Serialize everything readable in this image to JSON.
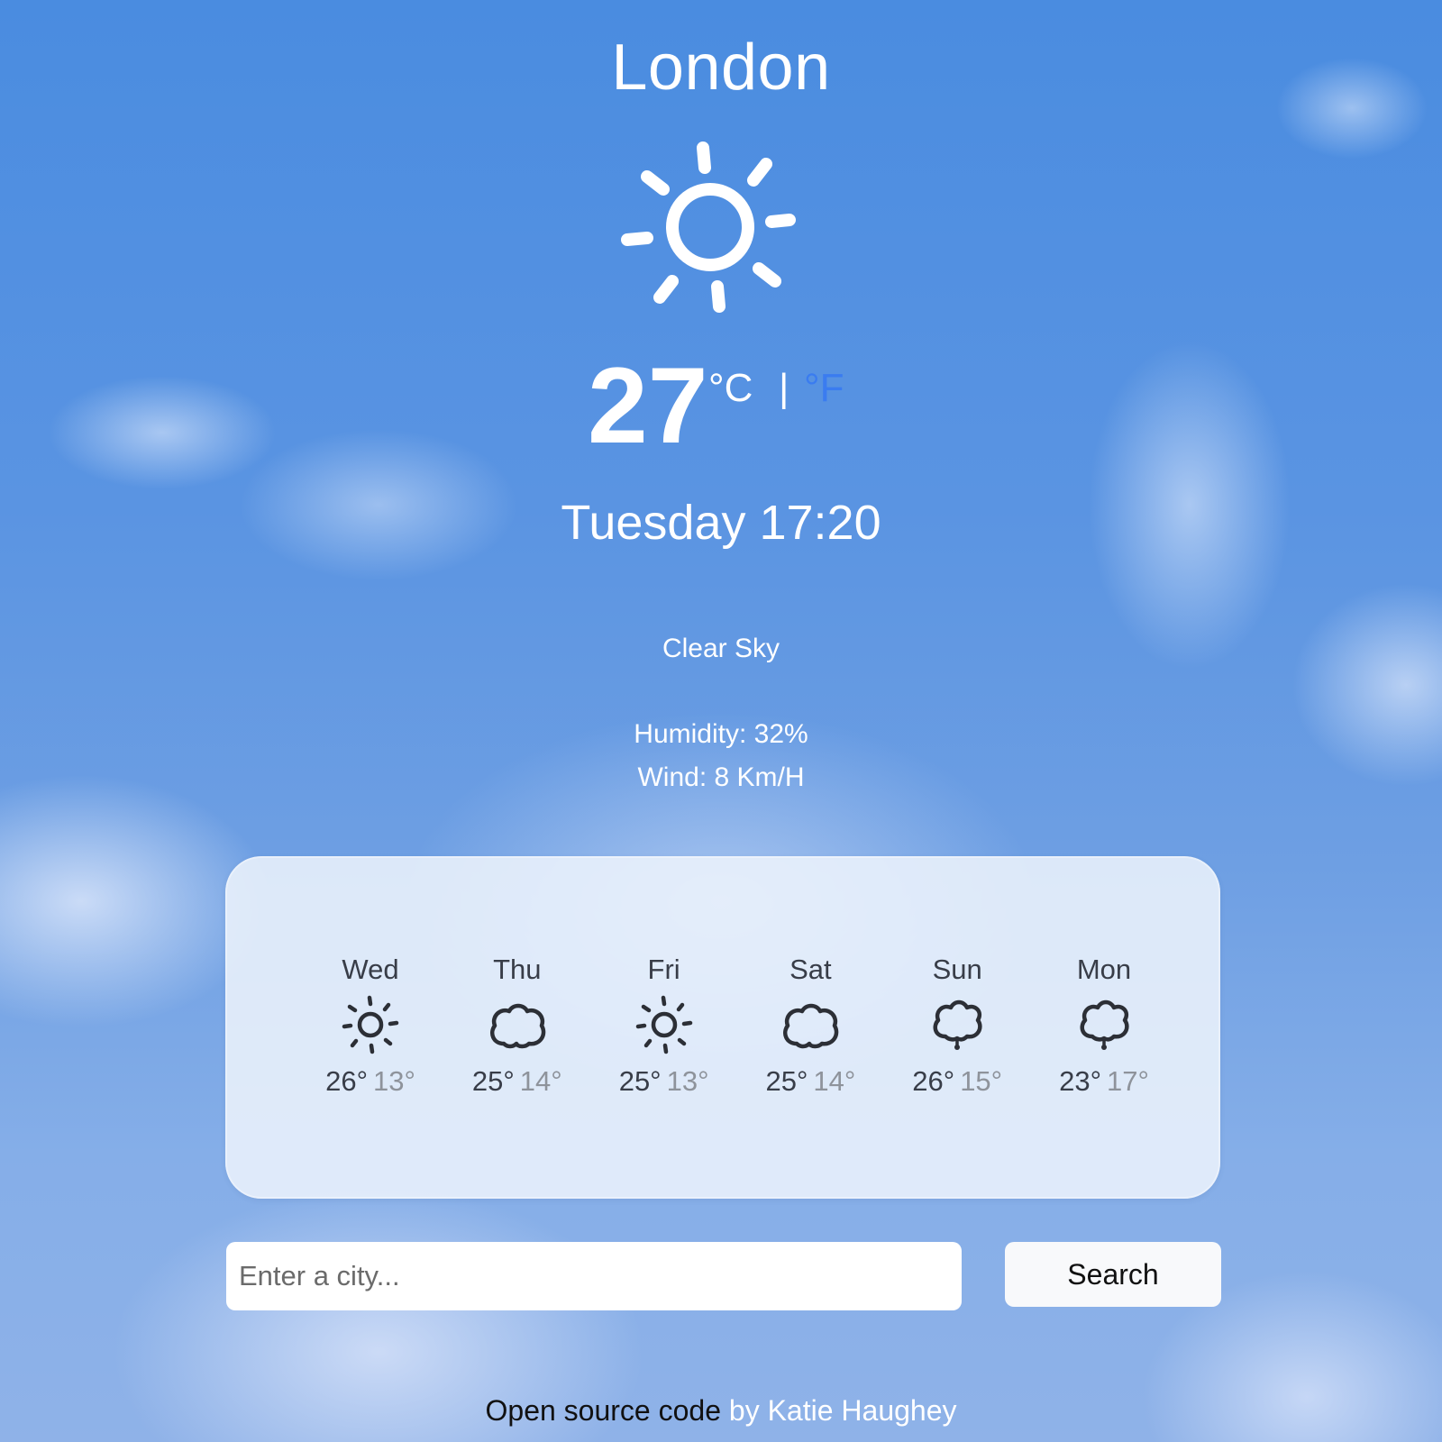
{
  "current": {
    "city": "London",
    "icon": "sun-icon",
    "temperature": "27",
    "unit_celsius": "°C",
    "unit_separator": "|",
    "unit_fahrenheit": "°F",
    "datetime": "Tuesday 17:20",
    "description": "Clear Sky",
    "humidity": "Humidity: 32%",
    "wind": "Wind: 8 Km/H"
  },
  "forecast": [
    {
      "day": "Wed",
      "icon": "sun-icon",
      "max": "26°",
      "min": "13°"
    },
    {
      "day": "Thu",
      "icon": "cloud-icon",
      "max": "25°",
      "min": "14°"
    },
    {
      "day": "Fri",
      "icon": "sun-icon",
      "max": "25°",
      "min": "13°"
    },
    {
      "day": "Sat",
      "icon": "cloud-icon",
      "max": "25°",
      "min": "14°"
    },
    {
      "day": "Sun",
      "icon": "cloud-drizzle-icon",
      "max": "26°",
      "min": "15°"
    },
    {
      "day": "Mon",
      "icon": "cloud-drizzle-icon",
      "max": "23°",
      "min": "17°"
    }
  ],
  "search": {
    "placeholder": "Enter a city...",
    "value": "",
    "button_label": "Search"
  },
  "footer": {
    "source_link": "Open source code",
    "author_text": "by Katie Haughey"
  },
  "colors": {
    "accent_link": "#3a7cf0",
    "forecast_text": "#383d48",
    "forecast_min": "#8e939b"
  }
}
